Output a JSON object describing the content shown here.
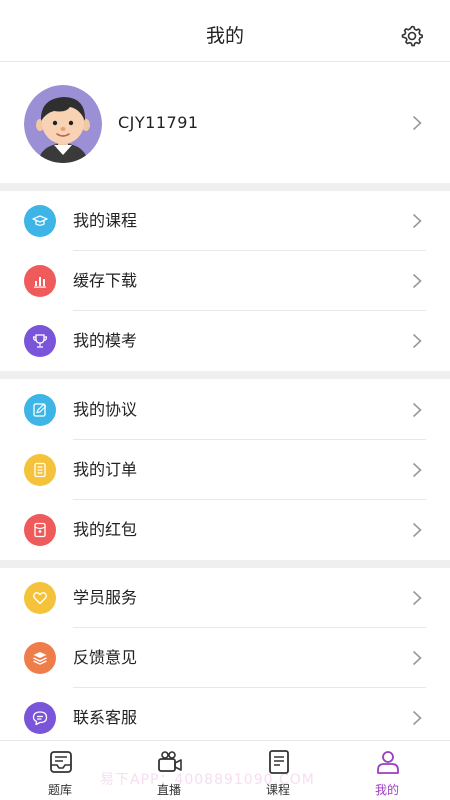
{
  "header": {
    "title": "我的",
    "settings_icon": "gear-icon"
  },
  "profile": {
    "username": "CJY11791",
    "avatar": "avatar-boy-illustration"
  },
  "menu_groups": [
    [
      {
        "label": "我的课程",
        "icon": "graduation-cap-icon",
        "color": "#3db5e6"
      },
      {
        "label": "缓存下载",
        "icon": "bar-chart-icon",
        "color": "#ef5a5a"
      },
      {
        "label": "我的模考",
        "icon": "trophy-icon",
        "color": "#7b55d9"
      }
    ],
    [
      {
        "label": "我的协议",
        "icon": "edit-document-icon",
        "color": "#3db5e6"
      },
      {
        "label": "我的订单",
        "icon": "order-list-icon",
        "color": "#f5c33b"
      },
      {
        "label": "我的红包",
        "icon": "red-envelope-icon",
        "color": "#ef5a5a"
      }
    ],
    [
      {
        "label": "学员服务",
        "icon": "heart-icon",
        "color": "#f5c33b"
      },
      {
        "label": "反馈意见",
        "icon": "stack-icon",
        "color": "#ef7d4a"
      },
      {
        "label": "联系客服",
        "icon": "chat-bubble-icon",
        "color": "#7b55d9"
      }
    ]
  ],
  "tabbar": {
    "tabs": [
      {
        "label": "题库",
        "icon": "question-bank-icon",
        "active": false
      },
      {
        "label": "直播",
        "icon": "video-camera-icon",
        "active": false
      },
      {
        "label": "课程",
        "icon": "course-book-icon",
        "active": false
      },
      {
        "label": "我的",
        "icon": "user-icon",
        "active": true
      }
    ],
    "active_color": "#9b3fc2"
  },
  "watermark": "易下APP：4008891090.COM"
}
